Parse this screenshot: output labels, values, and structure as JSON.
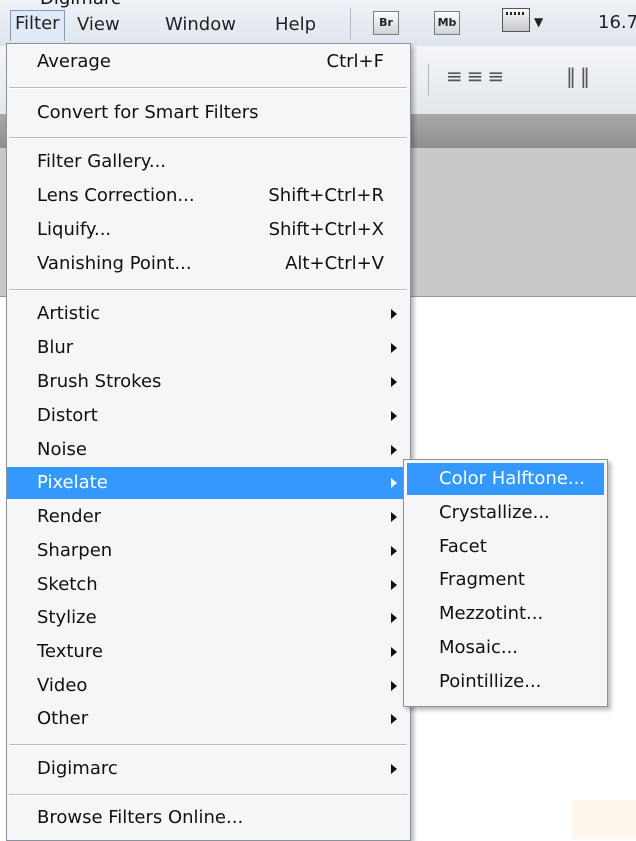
{
  "menubar": {
    "peek_label": "Digimarc",
    "menus": [
      "Filter",
      "View",
      "Window",
      "Help"
    ],
    "bridge_label": "Br",
    "minibridge_label": "Mb",
    "zoom": "16.7"
  },
  "filter_menu": {
    "groups": [
      [
        {
          "label": "Average",
          "shortcut": "Ctrl+F"
        }
      ],
      [
        {
          "label": "Convert for Smart Filters"
        }
      ],
      [
        {
          "label": "Filter Gallery..."
        },
        {
          "label": "Lens Correction...",
          "shortcut": "Shift+Ctrl+R"
        },
        {
          "label": "Liquify...",
          "shortcut": "Shift+Ctrl+X"
        },
        {
          "label": "Vanishing Point...",
          "shortcut": "Alt+Ctrl+V"
        }
      ],
      [
        {
          "label": "Artistic",
          "submenu": true
        },
        {
          "label": "Blur",
          "submenu": true
        },
        {
          "label": "Brush Strokes",
          "submenu": true
        },
        {
          "label": "Distort",
          "submenu": true
        },
        {
          "label": "Noise",
          "submenu": true
        },
        {
          "label": "Pixelate",
          "submenu": true,
          "selected": true
        },
        {
          "label": "Render",
          "submenu": true
        },
        {
          "label": "Sharpen",
          "submenu": true
        },
        {
          "label": "Sketch",
          "submenu": true
        },
        {
          "label": "Stylize",
          "submenu": true
        },
        {
          "label": "Texture",
          "submenu": true
        },
        {
          "label": "Video",
          "submenu": true
        },
        {
          "label": "Other",
          "submenu": true
        }
      ],
      [
        {
          "label": "Digimarc",
          "submenu": true
        }
      ],
      [
        {
          "label": "Browse Filters Online..."
        }
      ]
    ]
  },
  "pixelate_submenu": {
    "items": [
      {
        "label": "Color Halftone...",
        "selected": true
      },
      {
        "label": "Crystallize..."
      },
      {
        "label": "Facet"
      },
      {
        "label": "Fragment"
      },
      {
        "label": "Mezzotint..."
      },
      {
        "label": "Mosaic..."
      },
      {
        "label": "Pointillize..."
      }
    ]
  },
  "colors": {
    "highlight": "#3399ff",
    "menu_bg": "#f5f6f7",
    "canvas_gray": "#c9c9c9"
  }
}
